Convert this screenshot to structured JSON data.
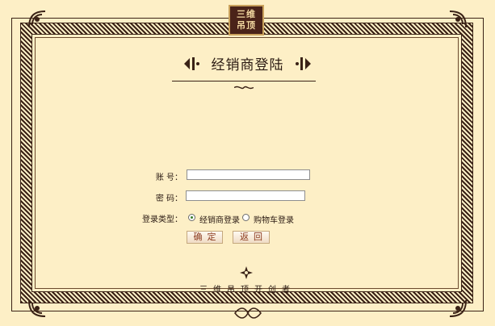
{
  "logo": {
    "line1": "三维",
    "line2": "吊顶"
  },
  "title": "经销商登陆",
  "form": {
    "account_label": "账 号：",
    "account_value": "",
    "password_label": "密 码：",
    "password_value": "",
    "login_type_label": "登录类型：",
    "options": [
      {
        "label": "经销商登录",
        "selected": true
      },
      {
        "label": "购物车登录",
        "selected": false
      }
    ],
    "confirm_label": "确定",
    "back_label": "返回"
  },
  "footer": "三维吊顶开创者",
  "colors": {
    "background": "#fdefc6",
    "frame": "#3a2216",
    "button_text": "#8b3a1e"
  }
}
